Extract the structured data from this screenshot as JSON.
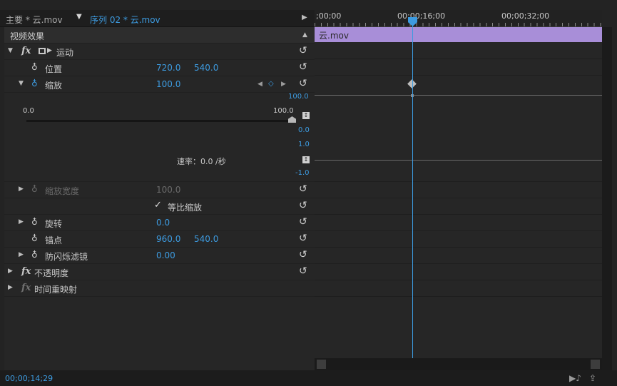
{
  "tabs": {
    "master": "主要 * 云.mov",
    "sequence": "序列 02 * 云.mov"
  },
  "panel_title": "视频效果",
  "effects": {
    "motion": {
      "label": "运动",
      "position": {
        "label": "位置",
        "x": "720.0",
        "y": "540.0"
      },
      "scale": {
        "label": "缩放",
        "value": "100.0",
        "slider_min": "0.0",
        "slider_max": "100.0",
        "graph_value_top": "100.0",
        "graph_value_bottom": "0.0",
        "velocity_top": "1.0",
        "velocity_bottom": "-1.0",
        "velocity_label": "速率：0.0 /秒"
      },
      "scale_width": {
        "label": "缩放宽度",
        "value": "100.0"
      },
      "uniform_scale": {
        "label": "等比缩放",
        "checked": true
      },
      "rotation": {
        "label": "旋转",
        "value": "0.0"
      },
      "anchor": {
        "label": "锚点",
        "x": "960.0",
        "y": "540.0"
      },
      "anti_flicker": {
        "label": "防闪烁滤镜",
        "value": "0.00"
      }
    },
    "opacity": {
      "label": "不透明度"
    },
    "time_remap": {
      "label": "时间重映射"
    }
  },
  "timeline": {
    "timecodes": [
      ";00;00",
      "00;00;16;00",
      "00;00;32;00"
    ],
    "clip_name": "云.mov"
  },
  "status": {
    "timecode": "00;00;14;29"
  },
  "icons": {
    "reset": "reset-icon",
    "stopwatch": "stopwatch-icon",
    "keyframe_prev": "prev-keyframe-icon",
    "keyframe_add": "add-keyframe-icon",
    "keyframe_next": "next-keyframe-icon"
  },
  "colors": {
    "accent": "#3d9be0",
    "clip": "#a88ed8",
    "background": "#262626"
  }
}
